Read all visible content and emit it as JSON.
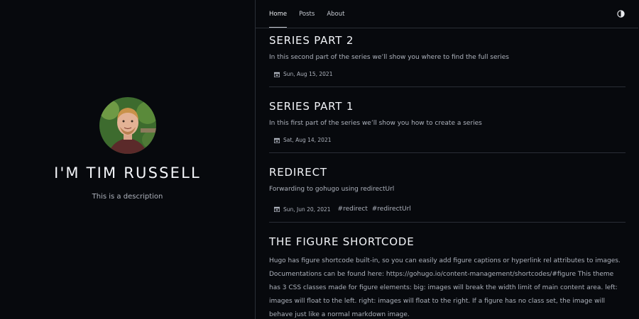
{
  "profile": {
    "name": "I'M TIM RUSSELL",
    "description": "This is a description",
    "avatar_icon": "avatar-photo-icon"
  },
  "nav": {
    "items": [
      {
        "label": "Home",
        "active": true
      },
      {
        "label": "Posts",
        "active": false
      },
      {
        "label": "About",
        "active": false
      }
    ],
    "theme_toggle_icon": "contrast-icon"
  },
  "posts": [
    {
      "title": "SERIES PART 2",
      "summary": "In this second part of the series we’ll show you where to find the full series",
      "date": "Sun, Aug 15, 2021",
      "tags": []
    },
    {
      "title": "SERIES PART 1",
      "summary": "In this first part of the series we’ll show you how to create a series",
      "date": "Sat, Aug 14, 2021",
      "tags": []
    },
    {
      "title": "REDIRECT",
      "summary": "Forwarding to gohugo using redirectUrl",
      "date": "Sun, Jun 20, 2021",
      "tags": [
        "#redirect",
        "#redirectUrl"
      ]
    },
    {
      "title": "THE FIGURE SHORTCODE",
      "summary": "Hugo has figure shortcode built-in, so you can easily add figure captions or hyperlink rel attributes to images. Documentations can be found here: https://gohugo.io/content-management/shortcodes/#figure This theme has 3 CSS classes made for figure elements: big: images will break the width limit of main content area. left: images will float to the left. right: images will float to the right. If a figure has no class set, the image will behave just like a normal markdown image.",
      "date": "",
      "tags": []
    }
  ],
  "colors": {
    "background": "#07090d",
    "divider": "#2a2e36",
    "heading": "#f2f4f8",
    "text": "#aeb3bd"
  }
}
